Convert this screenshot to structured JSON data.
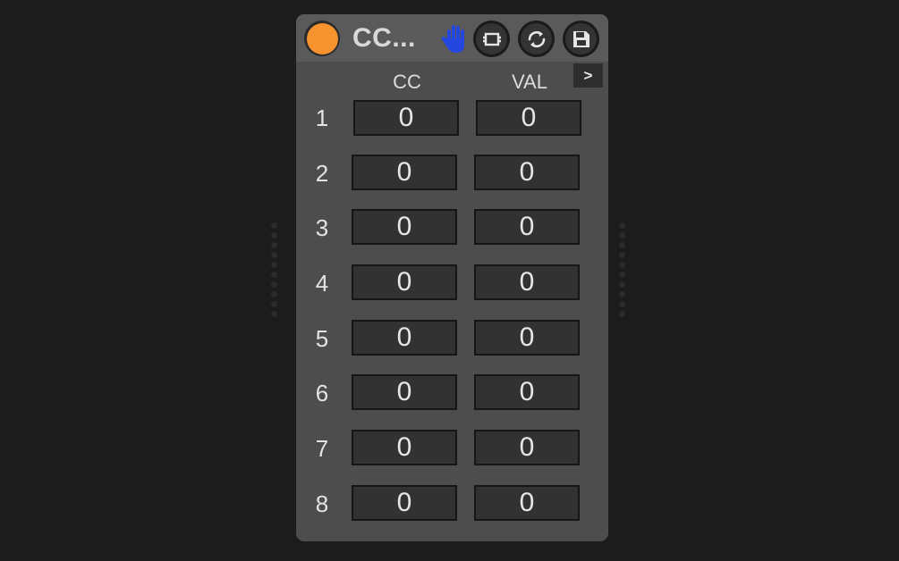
{
  "device": {
    "title": "CC...",
    "accent_color": "#f7932f",
    "hand_icon_color": "#2447e0",
    "expand_label": ">"
  },
  "columns": {
    "cc_label": "CC",
    "val_label": "VAL"
  },
  "rows": [
    {
      "label": "1",
      "cc": "0",
      "val": "0"
    },
    {
      "label": "2",
      "cc": "0",
      "val": "0"
    },
    {
      "label": "3",
      "cc": "0",
      "val": "0"
    },
    {
      "label": "4",
      "cc": "0",
      "val": "0"
    },
    {
      "label": "5",
      "cc": "0",
      "val": "0"
    },
    {
      "label": "6",
      "cc": "0",
      "val": "0"
    },
    {
      "label": "7",
      "cc": "0",
      "val": "0"
    },
    {
      "label": "8",
      "cc": "0",
      "val": "0"
    }
  ],
  "icons": {
    "power": "power-led-icon",
    "hand": "hand-icon",
    "map": "map-frame-icon",
    "sync": "sync-icon",
    "save": "save-icon"
  }
}
